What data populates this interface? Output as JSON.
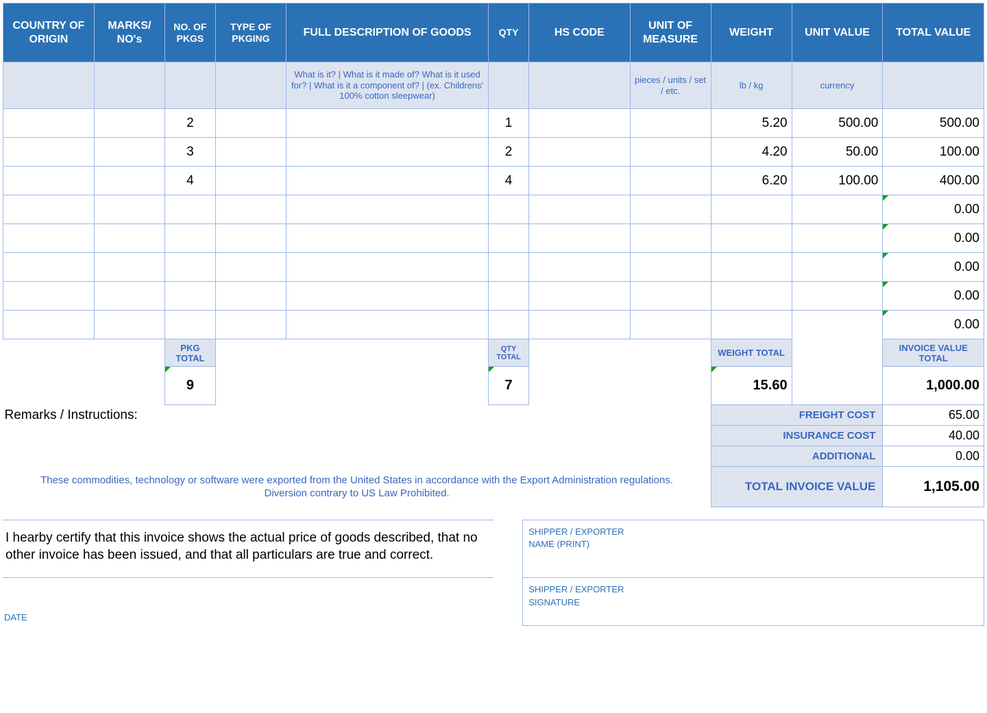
{
  "headers": {
    "c0": "COUNTRY OF ORIGIN",
    "c1": "MARKS/ NO's",
    "c2": "NO. OF PKGS",
    "c3": "TYPE OF PKGING",
    "c4": "FULL DESCRIPTION OF GOODS",
    "c5": "QTY",
    "c6": "HS CODE",
    "c7": "UNIT OF MEASURE",
    "c8": "WEIGHT",
    "c9": "UNIT VALUE",
    "c10": "TOTAL VALUE"
  },
  "hints": {
    "desc": "What is it? | What is it made of? What is it used for? | What is it a component of? | (ex. Childrens' 100% cotton sleepwear)",
    "uom": "pieces / units / set / etc.",
    "weight": "lb / kg",
    "uval": "currency"
  },
  "rows": [
    {
      "pkgs": "2",
      "qty": "1",
      "weight": "5.20",
      "uval": "500.00",
      "tval": "500.00"
    },
    {
      "pkgs": "3",
      "qty": "2",
      "weight": "4.20",
      "uval": "50.00",
      "tval": "100.00"
    },
    {
      "pkgs": "4",
      "qty": "4",
      "weight": "6.20",
      "uval": "100.00",
      "tval": "400.00"
    },
    {
      "pkgs": "",
      "qty": "",
      "weight": "",
      "uval": "",
      "tval": "0.00"
    },
    {
      "pkgs": "",
      "qty": "",
      "weight": "",
      "uval": "",
      "tval": "0.00"
    },
    {
      "pkgs": "",
      "qty": "",
      "weight": "",
      "uval": "",
      "tval": "0.00"
    },
    {
      "pkgs": "",
      "qty": "",
      "weight": "",
      "uval": "",
      "tval": "0.00"
    },
    {
      "pkgs": "",
      "qty": "",
      "weight": "",
      "uval": "",
      "tval": "0.00"
    }
  ],
  "totals": {
    "pkg_lbl": "PKG TOTAL",
    "qty_lbl": "QTY TOTAL",
    "weight_lbl": "WEIGHT TOTAL",
    "inv_lbl": "INVOICE VALUE TOTAL",
    "pkg": "9",
    "qty": "7",
    "weight": "15.60",
    "inv": "1,000.00"
  },
  "costs": {
    "freight_lbl": "FREIGHT COST",
    "freight": "65.00",
    "insurance_lbl": "INSURANCE COST",
    "insurance": "40.00",
    "additional_lbl": "ADDITIONAL",
    "additional": "0.00",
    "totinv_lbl": "TOTAL INVOICE VALUE",
    "totinv": "1,105.00"
  },
  "text": {
    "remarks": "Remarks / Instructions:",
    "disclaimer": "These commodities, technology or software were exported from the United States in accordance with the Export Administration regulations.  Diversion contrary to US Law Prohibited.",
    "certify": "I hearby certify that this invoice shows the actual price of goods described, that no other invoice has been issued, and that all particulars are true and correct.",
    "date": "DATE",
    "sig_name_a": "SHIPPER / EXPORTER",
    "sig_name_b": "NAME (PRINT)",
    "sig_sign_a": "SHIPPER / EXPORTER",
    "sig_sign_b": "SIGNATURE"
  }
}
